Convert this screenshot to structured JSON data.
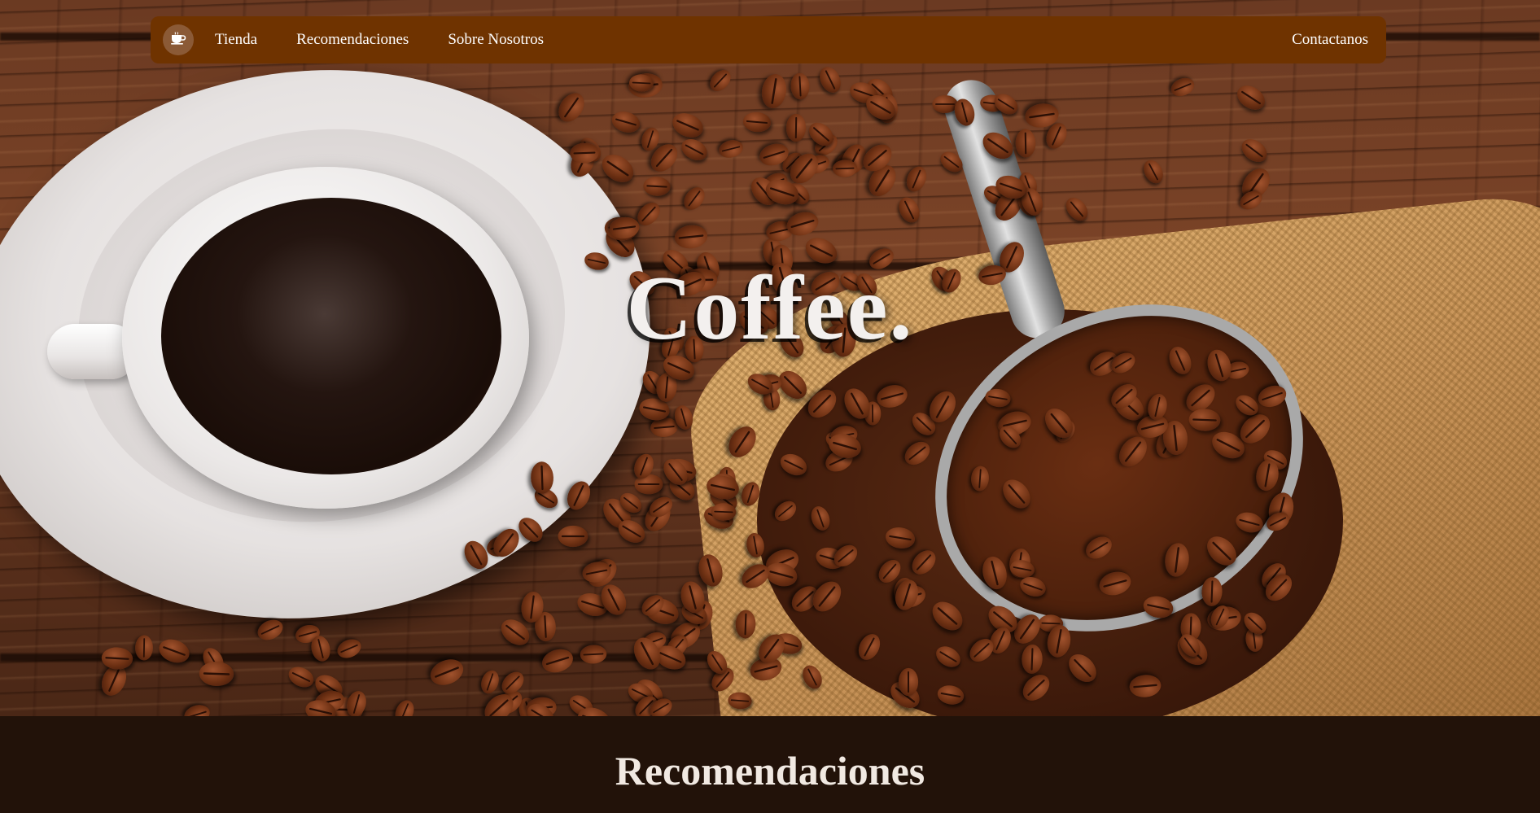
{
  "nav": {
    "logo_icon": "coffee-cup-icon",
    "items": [
      {
        "label": "Tienda"
      },
      {
        "label": "Recomendaciones"
      },
      {
        "label": "Sobre Nosotros"
      }
    ],
    "contact_label": "Contactanos",
    "bar_color": "#6f3300"
  },
  "hero": {
    "title": "Coffee."
  },
  "section": {
    "title": "Recomendaciones",
    "background_color": "#221209"
  }
}
